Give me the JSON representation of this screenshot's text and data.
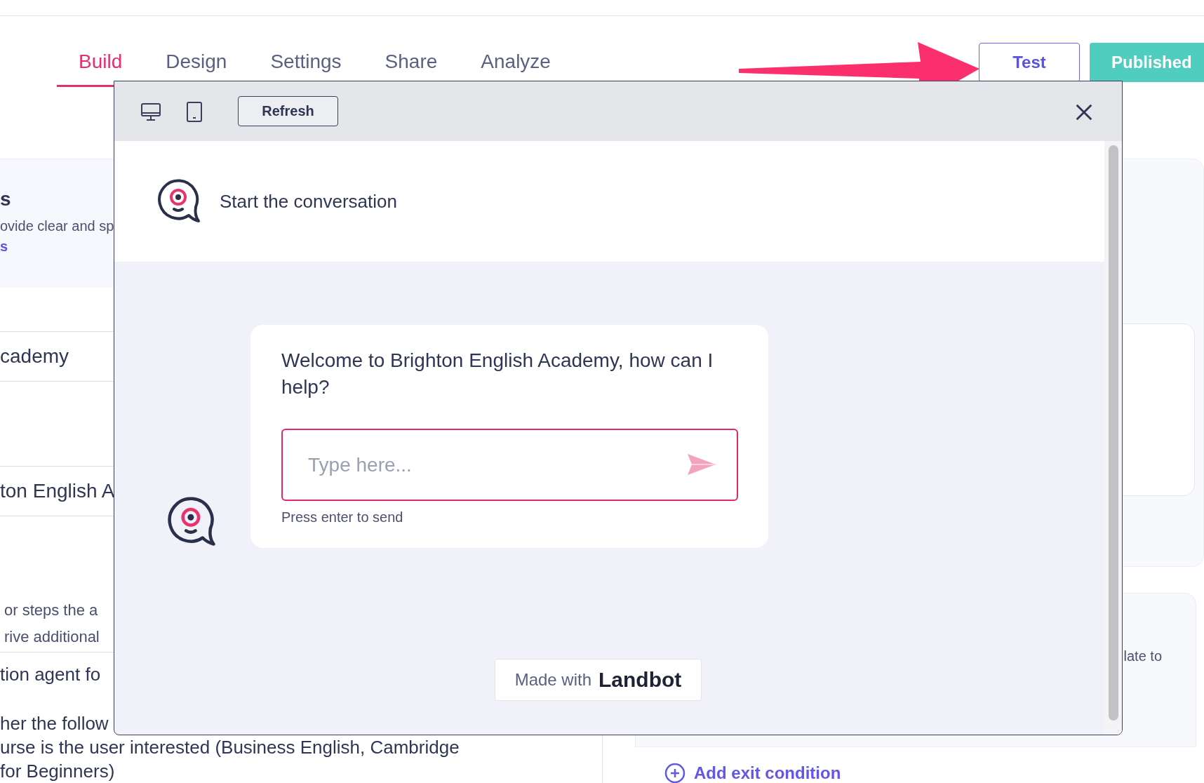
{
  "tabs": [
    {
      "label": "Build",
      "selected": true
    },
    {
      "label": "Design",
      "selected": false
    },
    {
      "label": "Settings",
      "selected": false
    },
    {
      "label": "Share",
      "selected": false
    },
    {
      "label": "Analyze",
      "selected": false
    }
  ],
  "actions": {
    "test": "Test",
    "published": "Published"
  },
  "left_panel": {
    "section_title": "s",
    "section_text": "ovide clear and sp",
    "section_link": "s",
    "fields": [
      "cademy",
      "ton English A"
    ],
    "description": [
      "or steps the a",
      "rive additional"
    ],
    "prompt_lines": [
      "tion agent fo",
      "her the follow",
      "urse is the user interested (Business English, Cambridge",
      "for Beginners)"
    ]
  },
  "right_panel": {
    "exit_text": "late to",
    "add_exit": "Add exit condition"
  },
  "preview": {
    "refresh": "Refresh",
    "header_text": "Start the conversation",
    "message": "Welcome to Brighton English Academy, how can I help?",
    "input": {
      "placeholder": "Type here..."
    },
    "hint": "Press enter to send",
    "badge": {
      "prefix": "Made with",
      "brand": "Landbot"
    }
  }
}
